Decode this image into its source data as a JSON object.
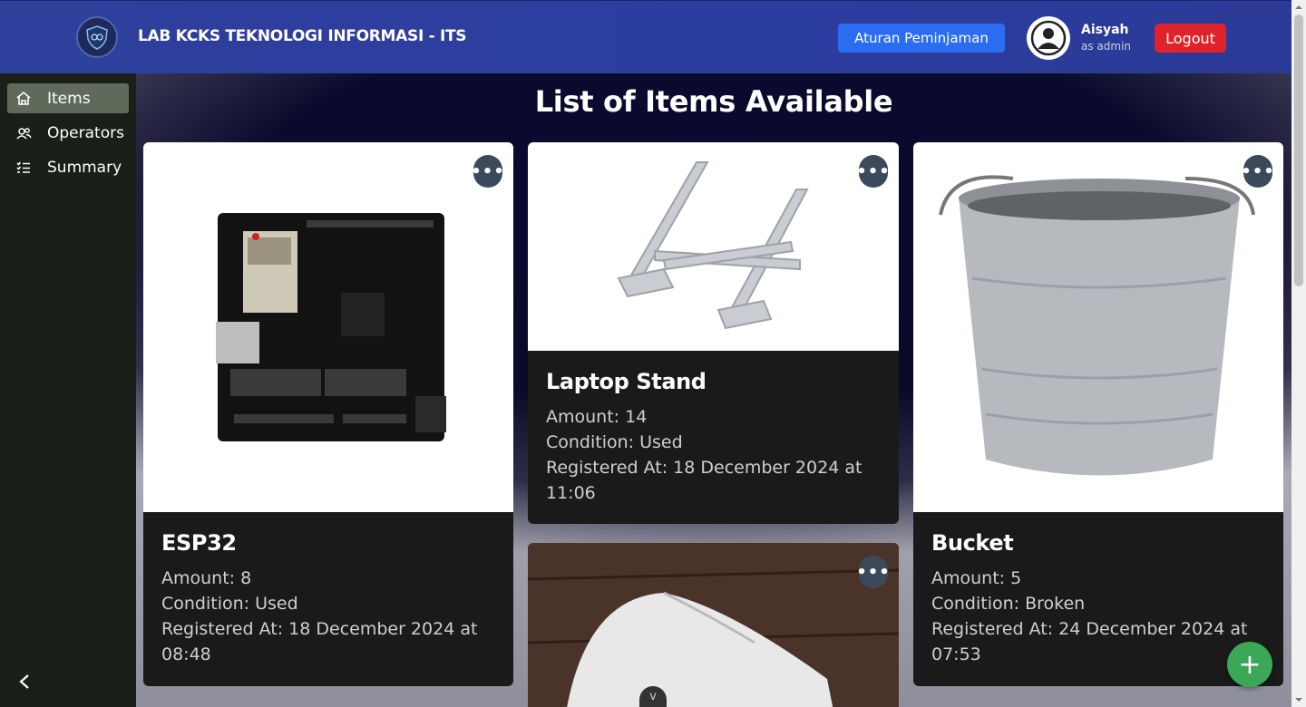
{
  "header": {
    "brand": "LAB KCKS TEKNOLOGI INFORMASI - ITS",
    "rules_button": "Aturan Peminjaman",
    "user_name": "Aisyah",
    "user_role": "as admin",
    "logout_button": "Logout"
  },
  "sidebar": {
    "items": [
      {
        "label": "Items",
        "icon": "home-icon",
        "active": true
      },
      {
        "label": "Operators",
        "icon": "users-icon",
        "active": false
      },
      {
        "label": "Summary",
        "icon": "list-icon",
        "active": false
      }
    ]
  },
  "main": {
    "title": "List of Items Available",
    "cards": [
      {
        "name": "ESP32",
        "amount": "Amount: 8",
        "condition": "Condition: Used",
        "registered": "Registered At: 18 December 2024 at 08:48"
      },
      {
        "name": "Laptop Stand",
        "amount": "Amount: 14",
        "condition": "Condition: Used",
        "registered": "Registered At: 18 December 2024 at 11:06"
      },
      {
        "name": "Bucket",
        "amount": "Amount: 5",
        "condition": "Condition: Broken",
        "registered": "Registered At: 24 December 2024 at 07:53"
      }
    ],
    "menu_glyph": "•••",
    "fab_glyph": "+",
    "scroll_hint_glyph": "v"
  },
  "colors": {
    "header": "#2e3f9c",
    "sidebar": "#1b1f1a",
    "active_nav": "#5f6a5a",
    "rules_button": "#2a6df0",
    "logout_button": "#e0232b",
    "fab": "#3aa857"
  }
}
